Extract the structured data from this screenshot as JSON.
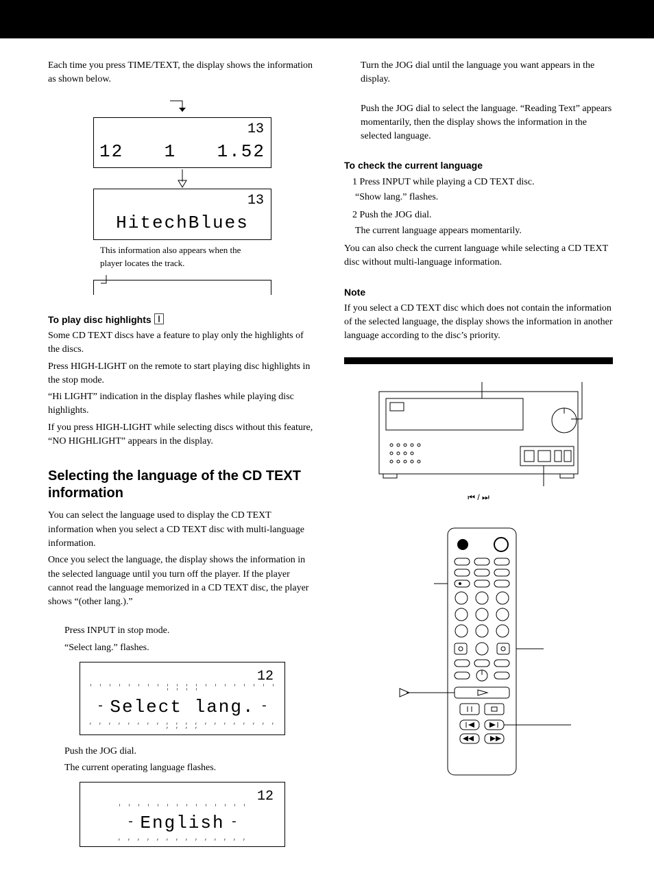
{
  "left": {
    "intro": "Each time you press TIME/TEXT, the display shows the information as shown below.",
    "disp1": {
      "top": "13",
      "a": "12",
      "b": "1",
      "c": "1.52"
    },
    "disp2": {
      "top": "13",
      "title": "HitechBlues"
    },
    "caption": "This information also appears when the player locates the track.",
    "highlights_head": "To play disc highlights",
    "hl1": "Some CD TEXT discs have a feature to play only the highlights of the discs.",
    "hl2": "Press HIGH-LIGHT on the remote to start playing disc highlights in the stop mode.",
    "hl3": "“Hi LIGHT” indication in the display flashes while playing disc highlights.",
    "hl4": "If you press HIGH-LIGHT while selecting discs without this feature, “NO HIGHLIGHT” appears in the display.",
    "subhead": "Selecting the language of the CD TEXT information",
    "sel1": "You can select the language used to display the CD TEXT information when you select a CD TEXT disc with multi-language information.",
    "sel2": "Once you select the language, the display shows the information in the selected language until you turn off the player. If the player cannot read the language memorized in a CD TEXT disc, the player shows “(other lang.).”",
    "step1a": "Press INPUT in stop mode.",
    "step1b": "“Select lang.” flashes.",
    "lcd1_num": "12",
    "lcd1_msg": "Select lang.",
    "step2a": "Push the JOG dial.",
    "step2b": "The current operating language flashes.",
    "lcd2_num": "12",
    "lcd2_msg": "English"
  },
  "right": {
    "turn": "Turn the JOG dial until the language you want appears in the display.",
    "push": "Push the JOG dial to select the language. “Reading Text” appears momentarily, then the display shows the information in the selected language.",
    "checkhead": "To check the current language",
    "c1": "1  Press INPUT while playing a CD TEXT disc.",
    "c1b": "“Show lang.” flashes.",
    "c2": "2  Push the JOG dial.",
    "c2b": "The current language appears momentarily.",
    "calso": "You can also check the current language while selecting a CD TEXT disc without multi-language information.",
    "notehead": "Note",
    "note": "If you select a CD TEXT disc which does not contain the information of the selected language, the display shows the information in another language according to the disc’s priority.",
    "skiplabel": "⏮ / ⏭"
  }
}
